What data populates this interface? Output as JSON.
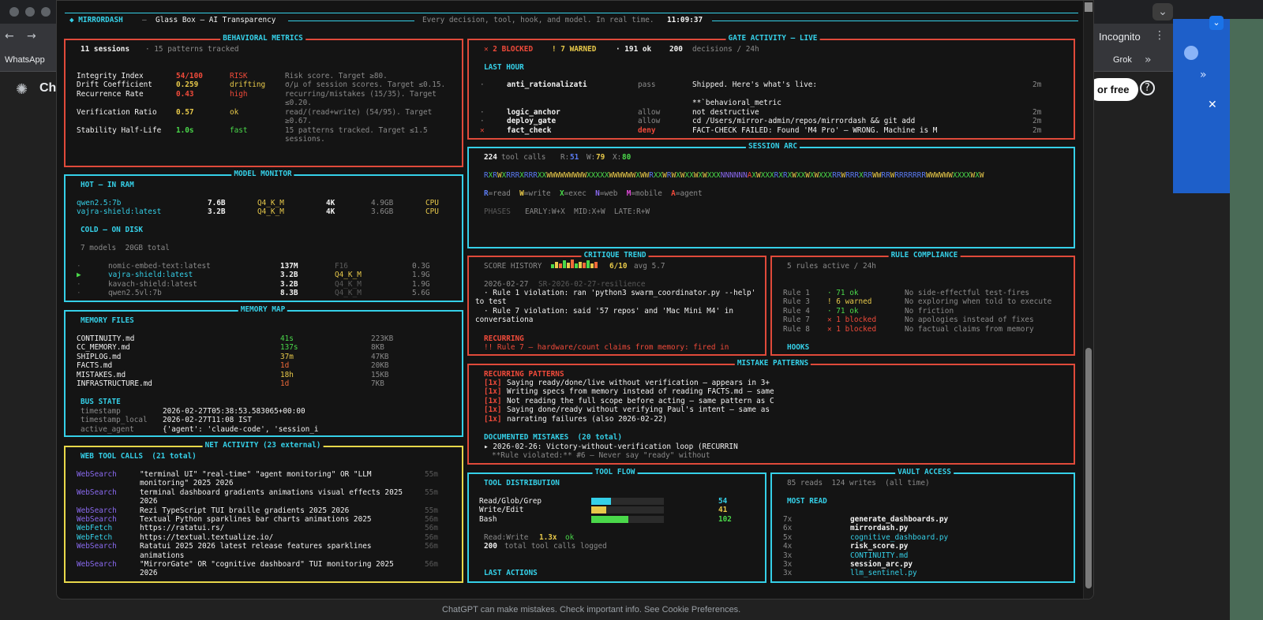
{
  "background": {
    "tab_whatsapp": "WhatsApp",
    "incognito": "Incognito",
    "grok": "Grok",
    "chat_short": "Ch",
    "try_free": "or free",
    "help_glyph": "?",
    "close_glyph": "✕",
    "page_caption": "ChatGPT can make mistakes. Check important info. See Cookie Preferences."
  },
  "header": {
    "brand": "◆ MIRRORDASH",
    "sep": "—",
    "subtitle": "Glass Box — AI Transparency",
    "tagline": "Every decision, tool, hook, and model. In real time.",
    "clock": "11:09:37"
  },
  "behavioral": {
    "title": "BEHAVIORAL METRICS",
    "sessions": "11 sessions",
    "patterns": "· 15 patterns tracked",
    "rows": [
      {
        "name": "Integrity Index",
        "value": "54/100",
        "status": "RISK",
        "desc": "Risk score. Target ≥80.",
        "desc2": "",
        "value_color": "red",
        "status_color": "red"
      },
      {
        "name": "Drift Coefficient",
        "value": "0.259",
        "status": "drifting",
        "desc": "σ/μ of session scores. Target ≤0.15.",
        "desc2": "",
        "value_color": "yel",
        "status_color": "yel"
      },
      {
        "name": "Recurrence Rate",
        "value": "0.43",
        "status": "high",
        "desc": "recurring/mistakes (15/35). Target",
        "desc2": "≤0.20.",
        "value_color": "red",
        "status_color": "red"
      },
      {
        "name": "Verification Ratio",
        "value": "0.57",
        "status": "ok",
        "desc": "read/(read+write) (54/95). Target",
        "desc2": "≥0.67.",
        "value_color": "yel",
        "status_color": "yel"
      },
      {
        "name": "Stability Half-Life",
        "value": "1.0s",
        "status": "fast",
        "desc": "15 patterns tracked. Target ≤1.5",
        "desc2": "sessions.",
        "value_color": "green",
        "status_color": "green"
      }
    ]
  },
  "gate": {
    "title": "GATE ACTIVITY — LIVE",
    "blocked": "✕ 2 BLOCKED",
    "warned": "! 7 WARNED",
    "ok": "· 191 ok",
    "decisions_count": "200",
    "decisions_label": "decisions / 24h",
    "last_hour": "LAST HOUR",
    "rows": [
      {
        "mark": "·",
        "name": "anti_rationalizati",
        "verdict": "pass",
        "detail": "Shipped. Here's what's live:",
        "age": "2m"
      },
      {
        "mark": "",
        "name": "",
        "verdict": "",
        "detail": "**`behavioral_metric",
        "age": ""
      },
      {
        "mark": "·",
        "name": "logic_anchor",
        "verdict": "allow",
        "detail": "not destructive",
        "age": "2m"
      },
      {
        "mark": "·",
        "name": "deploy_gate",
        "verdict": "allow",
        "detail": "cd /Users/mirror-admin/repos/mirrordash && git add",
        "age": "2m"
      },
      {
        "mark": "✕",
        "name": "fact_check",
        "verdict": "deny",
        "detail": "FACT-CHECK FAILED: Found 'M4 Pro' — WRONG. Machine is M",
        "age": "2m"
      }
    ]
  },
  "model": {
    "title": "MODEL MONITOR",
    "hot_title": "HOT — IN RAM",
    "hot": [
      {
        "name": "qwen2.5:7b",
        "params": "7.6B",
        "quant": "Q4_K_M",
        "ctx": "4K",
        "size": "4.9GB",
        "device": "CPU"
      },
      {
        "name": "vajra-shield:latest",
        "params": "3.2B",
        "quant": "Q4_K_M",
        "ctx": "4K",
        "size": "3.6GB",
        "device": "CPU"
      }
    ],
    "cold_title": "COLD — ON DISK",
    "cold_summary": "7 models  20GB total",
    "cold": [
      {
        "mark": "·",
        "name": "nomic-embed-text:latest",
        "params": "137M",
        "quant": "F16",
        "size": "0.3G",
        "active": false
      },
      {
        "mark": "▶",
        "name": "vajra-shield:latest",
        "params": "3.2B",
        "quant": "Q4_K_M",
        "size": "1.9G",
        "active": true
      },
      {
        "mark": "·",
        "name": "kavach-shield:latest",
        "params": "3.2B",
        "quant": "Q4_K_M",
        "size": "1.9G",
        "active": false
      },
      {
        "mark": "·",
        "name": "qwen2.5vl:7b",
        "params": "8.3B",
        "quant": "Q4_K_M",
        "size": "5.6G",
        "active": false
      }
    ]
  },
  "memory": {
    "title": "MEMORY MAP",
    "files_title": "MEMORY FILES",
    "files": [
      {
        "name": "CONTINUITY.md",
        "age": "41s",
        "size": "223KB",
        "color": "green"
      },
      {
        "name": "CC_MEMORY.md",
        "age": "137s",
        "size": "8KB",
        "color": "green"
      },
      {
        "name": "SHIPLOG.md",
        "age": "37m",
        "size": "47KB",
        "color": "yel"
      },
      {
        "name": "FACTS.md",
        "age": "1d",
        "size": "20KB",
        "color": "org"
      },
      {
        "name": "MISTAKES.md",
        "age": "18h",
        "size": "15KB",
        "color": "yel"
      },
      {
        "name": "INFRASTRUCTURE.md",
        "age": "1d",
        "size": "7KB",
        "color": "org"
      }
    ],
    "bus_title": "BUS STATE",
    "bus": [
      {
        "key": "timestamp",
        "val": "2026-02-27T05:38:53.583065+00:00"
      },
      {
        "key": "timestamp_local",
        "val": "2026-02-27T11:08 IST"
      },
      {
        "key": "active_agent",
        "val": "{'agent': 'claude-code', 'session_i"
      }
    ]
  },
  "net": {
    "title": "NET ACTIVITY (23 external)",
    "web_title": "WEB TOOL CALLS  (21 total)",
    "rows": [
      {
        "tool": "WebSearch",
        "q1": "\"terminal UI\" \"real-time\" \"agent monitoring\" OR \"LLM",
        "q2": "monitoring\" 2025 2026",
        "age": "55m"
      },
      {
        "tool": "WebSearch",
        "q1": "terminal dashboard gradients animations visual effects 2025",
        "q2": "2026",
        "age": "55m"
      },
      {
        "tool": "WebSearch",
        "q1": "Rezi TypeScript TUI braille gradients 2025 2026",
        "q2": "",
        "age": "55m"
      },
      {
        "tool": "WebSearch",
        "q1": "Textual Python sparklines bar charts animations 2025",
        "q2": "",
        "age": "56m"
      },
      {
        "tool": "WebFetch",
        "q1": "https://ratatui.rs/",
        "q2": "",
        "age": "56m"
      },
      {
        "tool": "WebFetch",
        "q1": "https://textual.textualize.io/",
        "q2": "",
        "age": "56m"
      },
      {
        "tool": "WebSearch",
        "q1": "Ratatui 2025 2026 latest release features sparklines",
        "q2": "animations",
        "age": "56m"
      },
      {
        "tool": "WebSearch",
        "q1": "\"MirrorGate\" OR \"cognitive dashboard\" TUI monitoring 2025",
        "q2": "2026",
        "age": "56m"
      }
    ]
  },
  "arc": {
    "title": "SESSION ARC",
    "calls_count": "224",
    "calls_label": "tool calls",
    "r_label": "R:",
    "r_val": "51",
    "w_label": "W:",
    "w_val": "79",
    "x_label": "X:",
    "x_val": "80",
    "sequence": "RXRWXRRRXRRRXXWWWWWWWWWXXXXXWWWWWWXWWRXXWRWXWXXWXWXXXNNNNNNAXWXXXRXRXWXXWXWXXXRRWRRRXRRWWRRWRRRRRRRWWWWWWXXXXWXW",
    "legend": [
      {
        "k": "R",
        "t": "=read",
        "c": "#5a7af0"
      },
      {
        "k": "W",
        "t": "=write",
        "c": "#e8c94a"
      },
      {
        "k": "X",
        "t": "=exec",
        "c": "#4ad84a"
      },
      {
        "k": "N",
        "t": "=web",
        "c": "#8a6af0"
      },
      {
        "k": "M",
        "t": "=mobile",
        "c": "#e04ad8"
      },
      {
        "k": "A",
        "t": "=agent",
        "c": "#f04a3a"
      }
    ],
    "phases_label": "PHASES",
    "phases": "EARLY:W+X  MID:X+W  LATE:R+W"
  },
  "critique": {
    "title": "CRITIQUE TREND",
    "score_label": "SCORE HISTORY",
    "score": "6/10",
    "avg": "avg 5.7",
    "sparkline": [
      4,
      7,
      5,
      8,
      6,
      9,
      5,
      7,
      6,
      8,
      5,
      7
    ],
    "date": "2026-02-27",
    "session": "SR-2026-02-27-resilience",
    "lines": [
      "· Rule 1 violation: ran 'python3 swarm_coordinator.py --help'",
      "to test",
      "· Rule 7 violation: said '57 repos' and 'Mac Mini M4' in",
      "conversationa"
    ],
    "recurring_title": "RECURRING",
    "recurring_line": "!! Rule 7 — hardware/count claims from memory: fired in"
  },
  "rules": {
    "title": "RULE COMPLIANCE",
    "summary": "5 rules active / 24h",
    "rows": [
      {
        "rule": "Rule 1",
        "status": "· 71 ok",
        "desc": "No side-effectful test-fires",
        "color": "green"
      },
      {
        "rule": "Rule 3",
        "status": "! 6 warned",
        "desc": "No exploring when told to execute",
        "color": "yel"
      },
      {
        "rule": "Rule 4",
        "status": "· 71 ok",
        "desc": "No friction",
        "color": "green"
      },
      {
        "rule": "Rule 7",
        "status": "✕ 1 blocked",
        "desc": "No apologies instead of fixes",
        "color": "red"
      },
      {
        "rule": "Rule 8",
        "status": "✕ 1 blocked",
        "desc": "No factual claims from memory",
        "color": "red"
      }
    ],
    "hooks_title": "HOOKS"
  },
  "mistakes": {
    "title": "MISTAKE PATTERNS",
    "recurring_title": "RECURRING PATTERNS",
    "rows": [
      {
        "count": "[1x]",
        "text": "Saying ready/done/live without verification — appears in 3+"
      },
      {
        "count": "[1x]",
        "text": "Writing specs from memory instead of reading FACTS.md — same"
      },
      {
        "count": "[1x]",
        "text": "Not reading the full scope before acting — same pattern as C"
      },
      {
        "count": "[1x]",
        "text": "Saying done/ready without verifying Paul's intent — same as"
      },
      {
        "count": "[1x]",
        "text": "narrating failures (also 2026-02-22)"
      }
    ],
    "documented_title": "DOCUMENTED MISTAKES  (20 total)",
    "documented_line": "▸ 2026-02-26: Victory-without-verification loop (RECURRIN",
    "documented_sub": "**Rule violated:** #6 — Never say \"ready\" without"
  },
  "toolflow": {
    "title": "TOOL FLOW",
    "dist_title": "TOOL DISTRIBUTION",
    "rows": [
      {
        "name": "Read/Glob/Grep",
        "count": "54",
        "value": 54,
        "color": "#35d0e8"
      },
      {
        "name": "Write/Edit",
        "count": "41",
        "value": 41,
        "color": "#e8c94a"
      },
      {
        "name": "Bash",
        "count": "102",
        "value": 102,
        "color": "#4ad84a"
      }
    ],
    "max": 200,
    "ratio_label": "Read:Write",
    "ratio_val": "1.3x",
    "ratio_status": "ok",
    "total_count": "200",
    "total_label": "total tool calls logged",
    "last_actions": "LAST ACTIONS"
  },
  "vault": {
    "title": "VAULT ACCESS",
    "summary": "85 reads  124 writes  (all time)",
    "most_read": "MOST READ",
    "rows": [
      {
        "count": "7x",
        "file": "generate_dashboards.py",
        "color": "white"
      },
      {
        "count": "6x",
        "file": "mirrordash.py",
        "color": "white"
      },
      {
        "count": "5x",
        "file": "cognitive_dashboard.py",
        "color": "cyan"
      },
      {
        "count": "4x",
        "file": "risk_score.py",
        "color": "white"
      },
      {
        "count": "3x",
        "file": "CONTINUITY.md",
        "color": "cyan"
      },
      {
        "count": "3x",
        "file": "session_arc.py",
        "color": "white"
      },
      {
        "count": "3x",
        "file": "llm_sentinel.py",
        "color": "cyan"
      }
    ]
  }
}
